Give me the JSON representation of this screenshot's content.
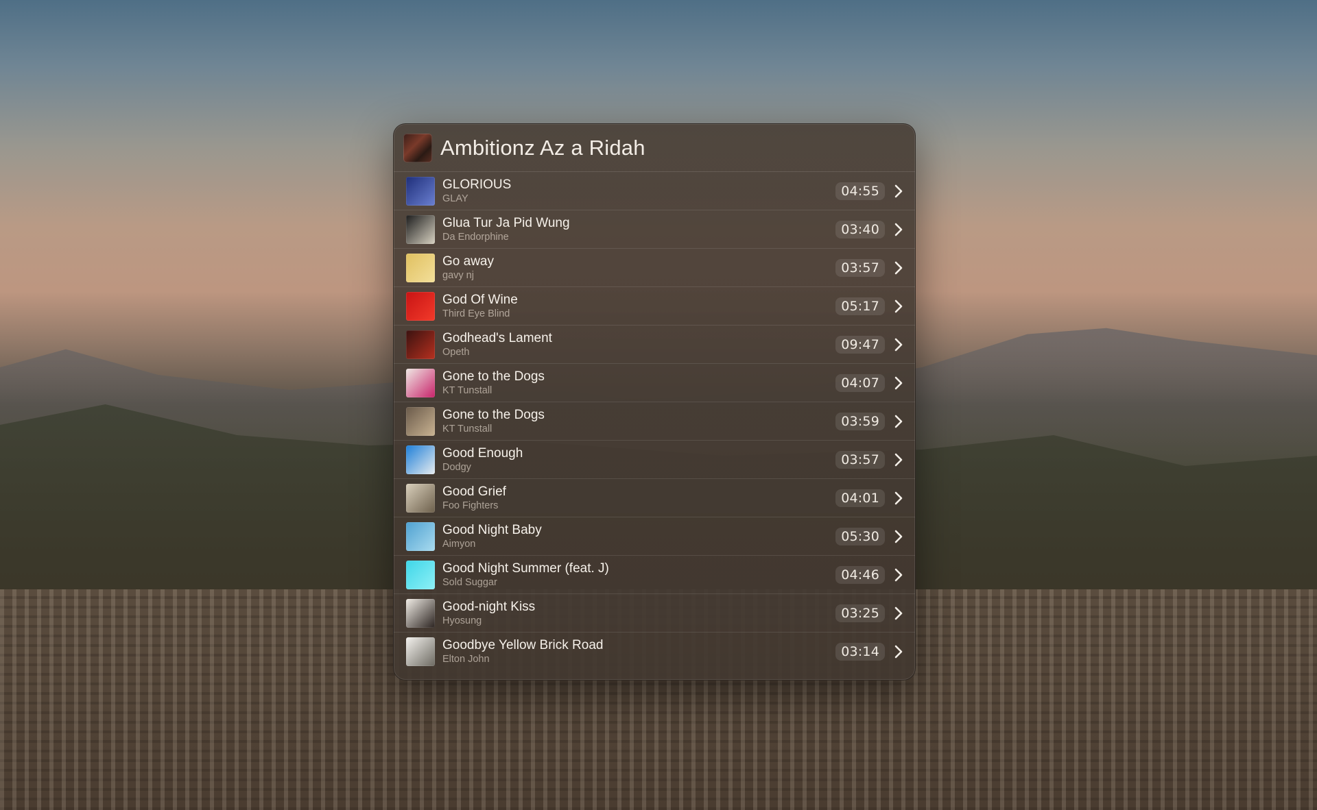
{
  "album": {
    "title": "Ambitionz Az a Ridah"
  },
  "icons": {
    "row_action": "chevron-right-icon"
  },
  "tracks": [
    {
      "title": "GLORIOUS",
      "artist": "GLAY",
      "duration": "04:55",
      "art_colors": [
        "#1f2f7a",
        "#6a7fd0"
      ]
    },
    {
      "title": "Glua Tur Ja Pid Wung",
      "artist": "Da Endorphine",
      "duration": "03:40",
      "art_colors": [
        "#1c1c1c",
        "#d8d2c2"
      ]
    },
    {
      "title": "Go away",
      "artist": "gavy nj",
      "duration": "03:57",
      "art_colors": [
        "#e0c060",
        "#f3df9a"
      ]
    },
    {
      "title": "God Of Wine",
      "artist": "Third Eye Blind",
      "duration": "05:17",
      "art_colors": [
        "#c81414",
        "#f23a2a"
      ]
    },
    {
      "title": "Godhead's Lament",
      "artist": "Opeth",
      "duration": "09:47",
      "art_colors": [
        "#3a1210",
        "#b6301f"
      ]
    },
    {
      "title": "Gone to the Dogs",
      "artist": "KT Tunstall",
      "duration": "04:07",
      "art_colors": [
        "#efe8e4",
        "#c8236a"
      ]
    },
    {
      "title": "Gone to the Dogs",
      "artist": "KT Tunstall",
      "duration": "03:59",
      "art_colors": [
        "#6a5a4a",
        "#c9b392"
      ]
    },
    {
      "title": "Good Enough",
      "artist": "Dodgy",
      "duration": "03:57",
      "art_colors": [
        "#1e7fd8",
        "#e7ecef"
      ]
    },
    {
      "title": "Good Grief",
      "artist": "Foo Fighters",
      "duration": "04:01",
      "art_colors": [
        "#d9cfbb",
        "#6d604c"
      ]
    },
    {
      "title": "Good Night Baby",
      "artist": "Aimyon",
      "duration": "05:30",
      "art_colors": [
        "#4fa1d1",
        "#a9dbef"
      ]
    },
    {
      "title": "Good Night Summer (feat. J)",
      "artist": "Sold Suggar",
      "duration": "04:46",
      "art_colors": [
        "#3fd6e8",
        "#8ef0f6"
      ]
    },
    {
      "title": "Good-night Kiss",
      "artist": "Hyosung",
      "duration": "03:25",
      "art_colors": [
        "#f1ede6",
        "#2b2320"
      ]
    },
    {
      "title": "Goodbye Yellow Brick Road",
      "artist": "Elton John",
      "duration": "03:14",
      "art_colors": [
        "#f4f2ee",
        "#6d6a62"
      ]
    }
  ]
}
